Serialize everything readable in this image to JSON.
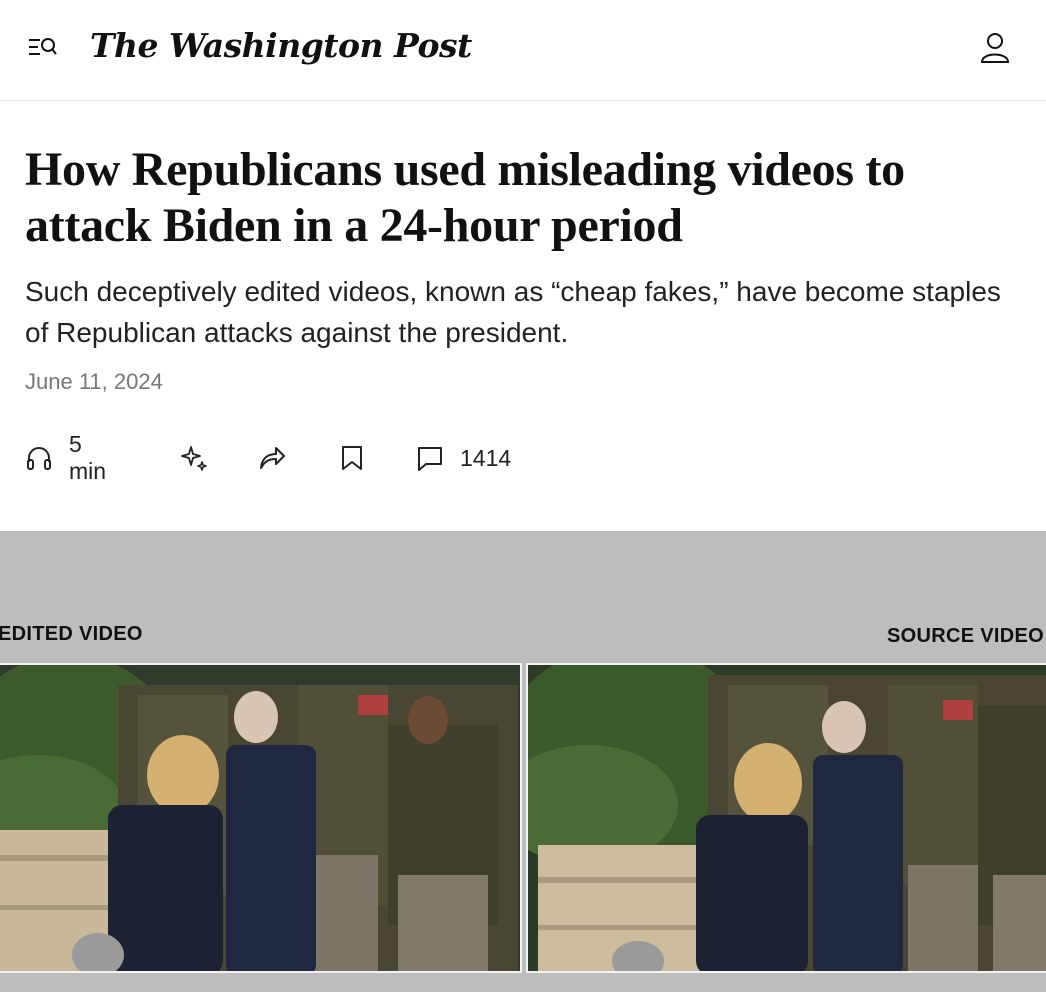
{
  "site": {
    "logo_text": "The Washington Post"
  },
  "header": {
    "menu_icon": "menu-search-icon",
    "account_icon": "account-icon"
  },
  "article": {
    "headline": "How Republicans used misleading videos to attack Biden in a 24-hour period",
    "dek": "Such deceptively edited videos, known as “cheap fakes,” have become staples of Republican attacks against the president.",
    "date": "June 11, 2024"
  },
  "toolbar": {
    "listen_label": "5 min",
    "listen_icon": "headphones-icon",
    "summary_icon": "sparkle-icon",
    "share_icon": "share-icon",
    "save_icon": "bookmark-icon",
    "comments_icon": "comment-icon",
    "comments_count": "1414"
  },
  "video": {
    "left_caption": "EDITED VIDEO",
    "right_caption": "SOURCE VIDEO",
    "background": "#bdbdbd"
  }
}
